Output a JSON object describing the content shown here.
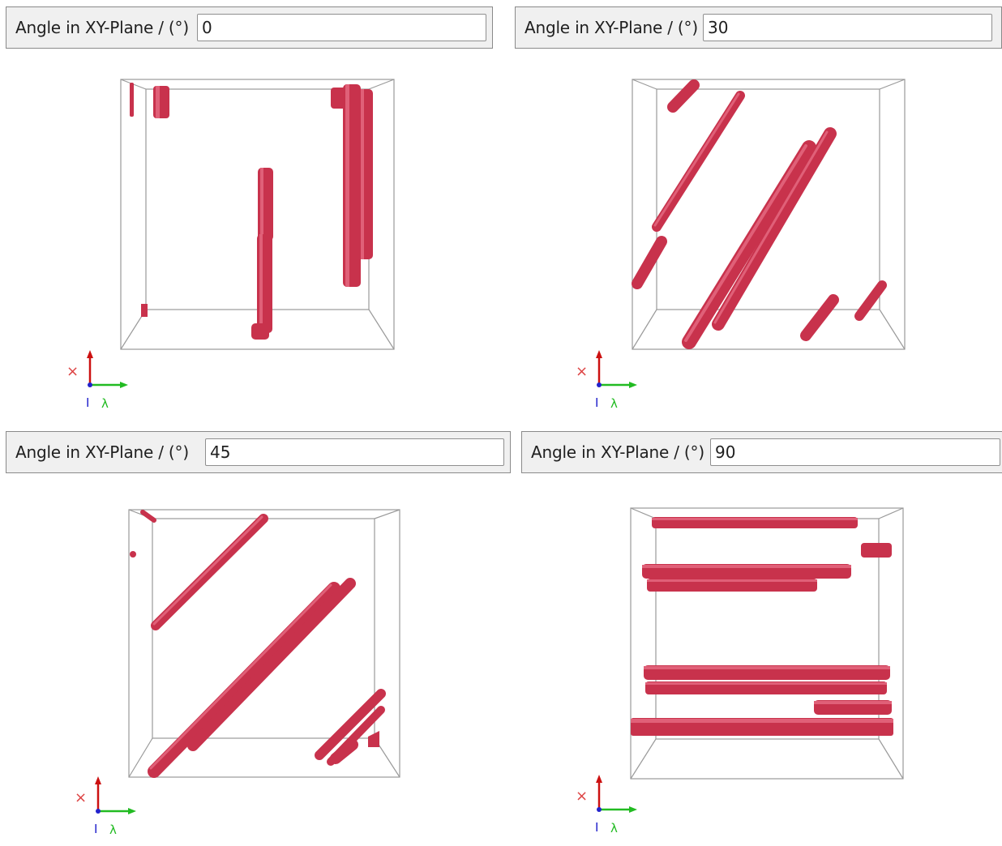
{
  "field_label": "Angle in XY-Plane / (°)",
  "panels": [
    {
      "angle_value": "0"
    },
    {
      "angle_value": "30"
    },
    {
      "angle_value": "45"
    },
    {
      "angle_value": "90"
    }
  ],
  "axis_labels": {
    "up": "I",
    "right": "λ"
  },
  "colors": {
    "fiber": "#c8324c",
    "fiber_highlight": "#e06078",
    "fiber_shadow": "#9a1e34",
    "box_edge": "#9a9a9a",
    "axis_up": "#cc1111",
    "axis_right": "#22bb22",
    "axis_depth": "#2222cc",
    "axis_x": "#dd4444"
  }
}
